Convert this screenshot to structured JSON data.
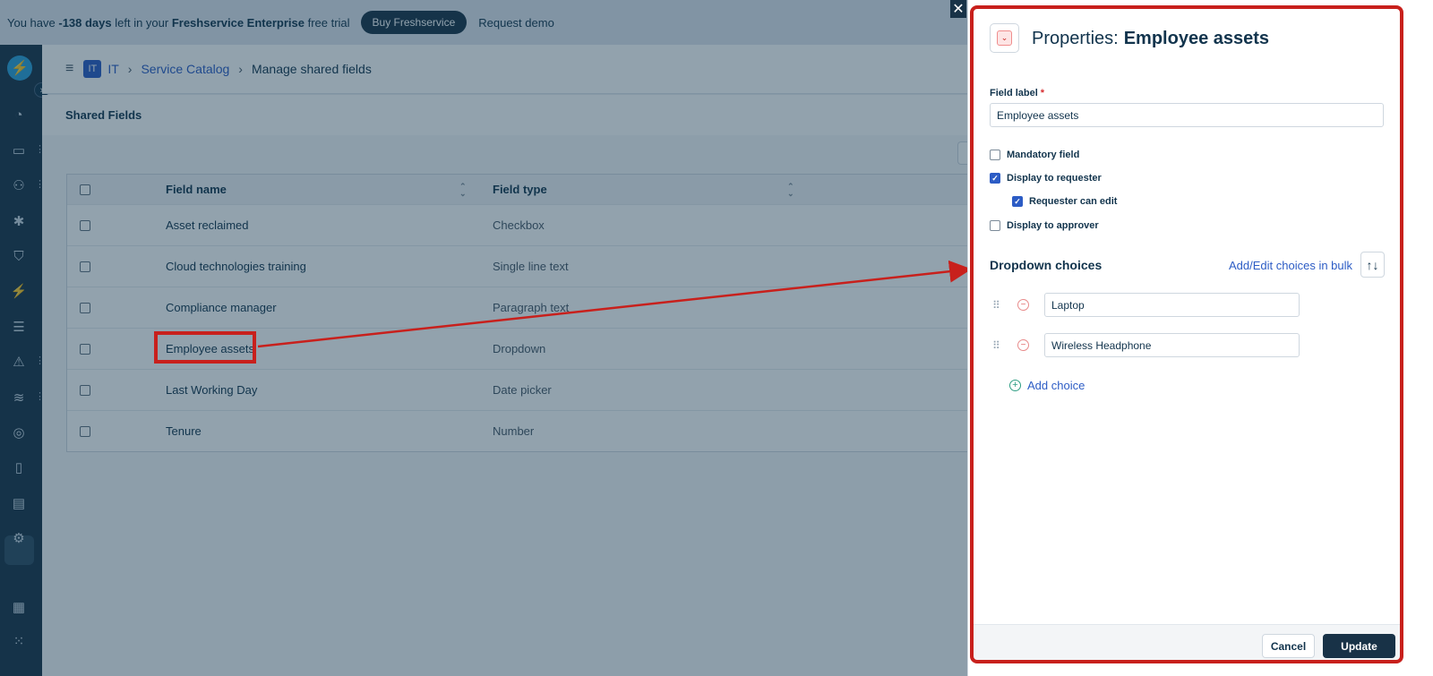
{
  "trial_bar": {
    "prefix": "You have ",
    "days": "-138 days",
    "middle": " left in your ",
    "product": "Freshservice Enterprise",
    "suffix": " free trial",
    "buy_label": "Buy Freshservice",
    "demo_label": "Request demo"
  },
  "breadcrumb": {
    "badge": "IT",
    "root": "IT",
    "section": "Service Catalog",
    "current": "Manage shared fields"
  },
  "subheader": {
    "title": "Shared Fields"
  },
  "table": {
    "columns": [
      "Field name",
      "Field type"
    ],
    "rows": [
      {
        "name": "Asset reclaimed",
        "type": "Checkbox"
      },
      {
        "name": "Cloud technologies training",
        "type": "Single line text"
      },
      {
        "name": "Compliance manager",
        "type": "Paragraph text"
      },
      {
        "name": "Employee assets",
        "type": "Dropdown"
      },
      {
        "name": "Last Working Day",
        "type": "Date picker"
      },
      {
        "name": "Tenure",
        "type": "Number"
      }
    ]
  },
  "panel": {
    "title_prefix": "Properties:",
    "title_name": "Employee assets",
    "field_label": "Field label",
    "required_mark": "*",
    "field_value": "Employee assets",
    "options": {
      "mandatory": {
        "label": "Mandatory field",
        "checked": false
      },
      "display_requester": {
        "label": "Display to requester",
        "checked": true
      },
      "requester_edit": {
        "label": "Requester can edit",
        "checked": true
      },
      "display_approver": {
        "label": "Display to approver",
        "checked": false
      }
    },
    "dropdown_title": "Dropdown choices",
    "bulk_link": "Add/Edit choices in bulk",
    "choices": [
      "Laptop",
      "Wireless Headphone"
    ],
    "add_choice": "Add choice",
    "cancel_label": "Cancel",
    "update_label": "Update"
  },
  "colors": {
    "highlight": "#c8201c",
    "primary_link": "#2c5cc5",
    "dark_nav": "#183247"
  },
  "icons": {
    "close": "close-icon",
    "sort": "sort-icon",
    "drag": "drag-handle-icon",
    "remove": "remove-icon",
    "add": "add-icon"
  }
}
